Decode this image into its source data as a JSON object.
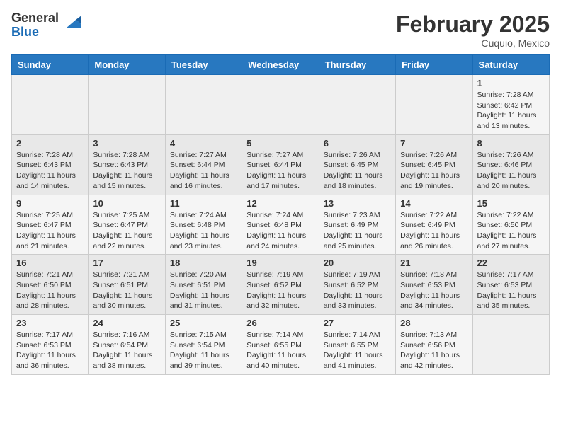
{
  "header": {
    "logo_general": "General",
    "logo_blue": "Blue",
    "month_title": "February 2025",
    "location": "Cuquio, Mexico"
  },
  "days_of_week": [
    "Sunday",
    "Monday",
    "Tuesday",
    "Wednesday",
    "Thursday",
    "Friday",
    "Saturday"
  ],
  "weeks": [
    [
      {
        "day": "",
        "info": ""
      },
      {
        "day": "",
        "info": ""
      },
      {
        "day": "",
        "info": ""
      },
      {
        "day": "",
        "info": ""
      },
      {
        "day": "",
        "info": ""
      },
      {
        "day": "",
        "info": ""
      },
      {
        "day": "1",
        "info": "Sunrise: 7:28 AM\nSunset: 6:42 PM\nDaylight: 11 hours\nand 13 minutes."
      }
    ],
    [
      {
        "day": "2",
        "info": "Sunrise: 7:28 AM\nSunset: 6:43 PM\nDaylight: 11 hours\nand 14 minutes."
      },
      {
        "day": "3",
        "info": "Sunrise: 7:28 AM\nSunset: 6:43 PM\nDaylight: 11 hours\nand 15 minutes."
      },
      {
        "day": "4",
        "info": "Sunrise: 7:27 AM\nSunset: 6:44 PM\nDaylight: 11 hours\nand 16 minutes."
      },
      {
        "day": "5",
        "info": "Sunrise: 7:27 AM\nSunset: 6:44 PM\nDaylight: 11 hours\nand 17 minutes."
      },
      {
        "day": "6",
        "info": "Sunrise: 7:26 AM\nSunset: 6:45 PM\nDaylight: 11 hours\nand 18 minutes."
      },
      {
        "day": "7",
        "info": "Sunrise: 7:26 AM\nSunset: 6:45 PM\nDaylight: 11 hours\nand 19 minutes."
      },
      {
        "day": "8",
        "info": "Sunrise: 7:26 AM\nSunset: 6:46 PM\nDaylight: 11 hours\nand 20 minutes."
      }
    ],
    [
      {
        "day": "9",
        "info": "Sunrise: 7:25 AM\nSunset: 6:47 PM\nDaylight: 11 hours\nand 21 minutes."
      },
      {
        "day": "10",
        "info": "Sunrise: 7:25 AM\nSunset: 6:47 PM\nDaylight: 11 hours\nand 22 minutes."
      },
      {
        "day": "11",
        "info": "Sunrise: 7:24 AM\nSunset: 6:48 PM\nDaylight: 11 hours\nand 23 minutes."
      },
      {
        "day": "12",
        "info": "Sunrise: 7:24 AM\nSunset: 6:48 PM\nDaylight: 11 hours\nand 24 minutes."
      },
      {
        "day": "13",
        "info": "Sunrise: 7:23 AM\nSunset: 6:49 PM\nDaylight: 11 hours\nand 25 minutes."
      },
      {
        "day": "14",
        "info": "Sunrise: 7:22 AM\nSunset: 6:49 PM\nDaylight: 11 hours\nand 26 minutes."
      },
      {
        "day": "15",
        "info": "Sunrise: 7:22 AM\nSunset: 6:50 PM\nDaylight: 11 hours\nand 27 minutes."
      }
    ],
    [
      {
        "day": "16",
        "info": "Sunrise: 7:21 AM\nSunset: 6:50 PM\nDaylight: 11 hours\nand 28 minutes."
      },
      {
        "day": "17",
        "info": "Sunrise: 7:21 AM\nSunset: 6:51 PM\nDaylight: 11 hours\nand 30 minutes."
      },
      {
        "day": "18",
        "info": "Sunrise: 7:20 AM\nSunset: 6:51 PM\nDaylight: 11 hours\nand 31 minutes."
      },
      {
        "day": "19",
        "info": "Sunrise: 7:19 AM\nSunset: 6:52 PM\nDaylight: 11 hours\nand 32 minutes."
      },
      {
        "day": "20",
        "info": "Sunrise: 7:19 AM\nSunset: 6:52 PM\nDaylight: 11 hours\nand 33 minutes."
      },
      {
        "day": "21",
        "info": "Sunrise: 7:18 AM\nSunset: 6:53 PM\nDaylight: 11 hours\nand 34 minutes."
      },
      {
        "day": "22",
        "info": "Sunrise: 7:17 AM\nSunset: 6:53 PM\nDaylight: 11 hours\nand 35 minutes."
      }
    ],
    [
      {
        "day": "23",
        "info": "Sunrise: 7:17 AM\nSunset: 6:53 PM\nDaylight: 11 hours\nand 36 minutes."
      },
      {
        "day": "24",
        "info": "Sunrise: 7:16 AM\nSunset: 6:54 PM\nDaylight: 11 hours\nand 38 minutes."
      },
      {
        "day": "25",
        "info": "Sunrise: 7:15 AM\nSunset: 6:54 PM\nDaylight: 11 hours\nand 39 minutes."
      },
      {
        "day": "26",
        "info": "Sunrise: 7:14 AM\nSunset: 6:55 PM\nDaylight: 11 hours\nand 40 minutes."
      },
      {
        "day": "27",
        "info": "Sunrise: 7:14 AM\nSunset: 6:55 PM\nDaylight: 11 hours\nand 41 minutes."
      },
      {
        "day": "28",
        "info": "Sunrise: 7:13 AM\nSunset: 6:56 PM\nDaylight: 11 hours\nand 42 minutes."
      },
      {
        "day": "",
        "info": ""
      }
    ]
  ]
}
